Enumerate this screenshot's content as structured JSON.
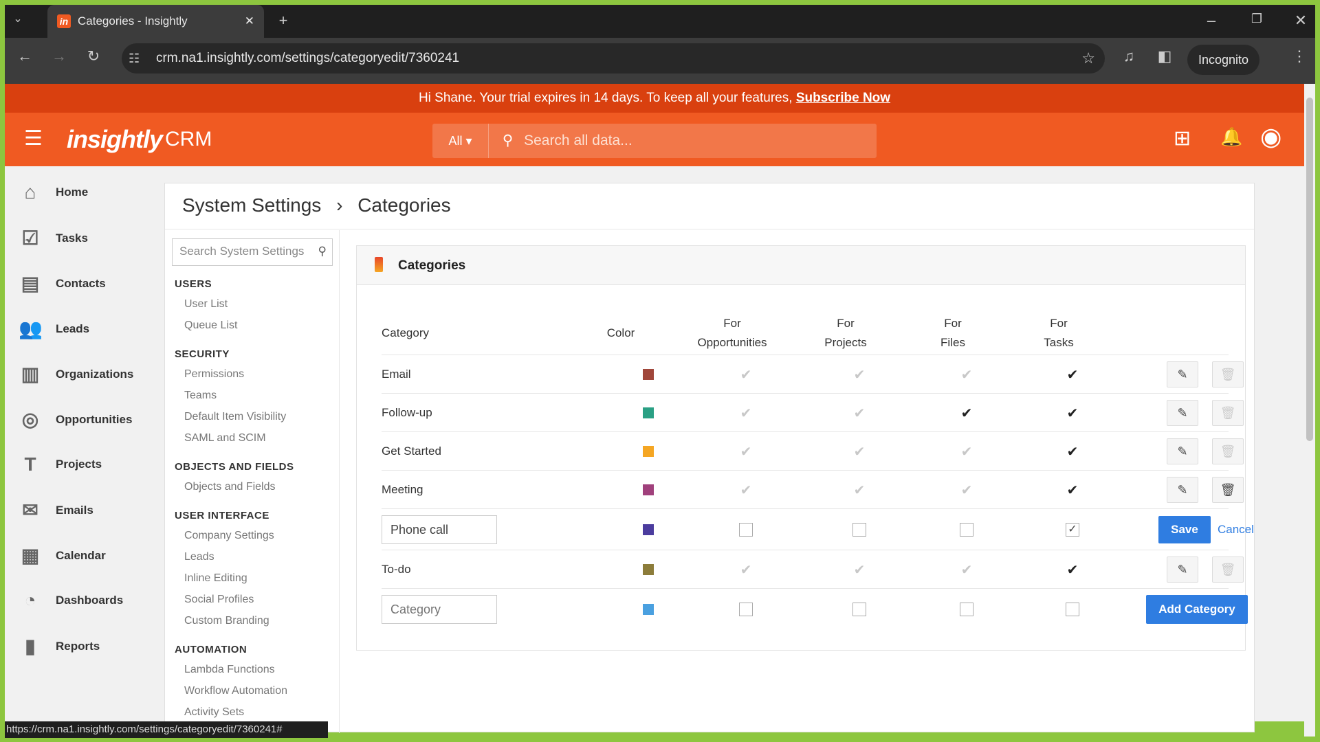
{
  "browser": {
    "tab_title": "Categories - Insightly",
    "url": "crm.na1.insightly.com/settings/categoryedit/7360241",
    "profile": "Incognito",
    "status_url": "https://crm.na1.insightly.com/settings/categoryedit/7360241#"
  },
  "banner": {
    "text": "Hi Shane. Your trial expires in 14 days. To keep all your features, ",
    "link": "Subscribe Now"
  },
  "header": {
    "logo": "insightly",
    "product": "CRM",
    "scope": "All ▾",
    "search_placeholder": "Search all data...",
    "brand_color": "#f05a22"
  },
  "sidebar": [
    {
      "label": "Home",
      "icon": "⌂"
    },
    {
      "label": "Tasks",
      "icon": "☑"
    },
    {
      "label": "Contacts",
      "icon": "▤"
    },
    {
      "label": "Leads",
      "icon": "👥"
    },
    {
      "label": "Organizations",
      "icon": "▥"
    },
    {
      "label": "Opportunities",
      "icon": "◎"
    },
    {
      "label": "Projects",
      "icon": "T"
    },
    {
      "label": "Emails",
      "icon": "✉"
    },
    {
      "label": "Calendar",
      "icon": "▦"
    },
    {
      "label": "Dashboards",
      "icon": "◔"
    },
    {
      "label": "Reports",
      "icon": "▮"
    }
  ],
  "breadcrumb": {
    "parent": "System Settings",
    "sep": "›",
    "current": "Categories"
  },
  "settings_nav": {
    "search_placeholder": "Search System Settings",
    "sections": [
      {
        "title": "USERS",
        "items": [
          "User List",
          "Queue List"
        ]
      },
      {
        "title": "SECURITY",
        "items": [
          "Permissions",
          "Teams",
          "Default Item Visibility",
          "SAML and SCIM"
        ]
      },
      {
        "title": "OBJECTS AND FIELDS",
        "items": [
          "Objects and Fields"
        ]
      },
      {
        "title": "USER INTERFACE",
        "items": [
          "Company Settings",
          "Leads",
          "Inline Editing",
          "Social Profiles",
          "Custom Branding"
        ]
      },
      {
        "title": "AUTOMATION",
        "items": [
          "Lambda Functions",
          "Workflow Automation",
          "Activity Sets"
        ]
      }
    ]
  },
  "panel": {
    "title": "Categories",
    "columns": {
      "category": "Category",
      "color": "Color",
      "opp1": "For",
      "opp2": "Opportunities",
      "proj1": "For",
      "proj2": "Projects",
      "files1": "For",
      "files2": "Files",
      "tasks1": "For",
      "tasks2": "Tasks"
    },
    "rows": [
      {
        "name": "Email",
        "color": "#a0463a",
        "opp": false,
        "proj": false,
        "files": false,
        "tasks": true,
        "deletable": false
      },
      {
        "name": "Follow-up",
        "color": "#2aa084",
        "opp": false,
        "proj": false,
        "files": true,
        "tasks": true,
        "deletable": false
      },
      {
        "name": "Get Started",
        "color": "#f5a623",
        "opp": false,
        "proj": false,
        "files": false,
        "tasks": true,
        "deletable": false
      },
      {
        "name": "Meeting",
        "color": "#a0407c",
        "opp": false,
        "proj": false,
        "files": false,
        "tasks": true,
        "deletable": true
      },
      {
        "name": "Phone call",
        "color": "#4b3c9e",
        "opp": false,
        "proj": false,
        "files": false,
        "tasks": true,
        "editing": true
      },
      {
        "name": "To-do",
        "color": "#8c7c3a",
        "opp": false,
        "proj": false,
        "files": false,
        "tasks": true,
        "deletable": false
      }
    ],
    "save": "Save",
    "cancel": "Cancel",
    "new_row": {
      "placeholder": "Category",
      "color": "#4aa0e0",
      "add": "Add Category"
    }
  }
}
